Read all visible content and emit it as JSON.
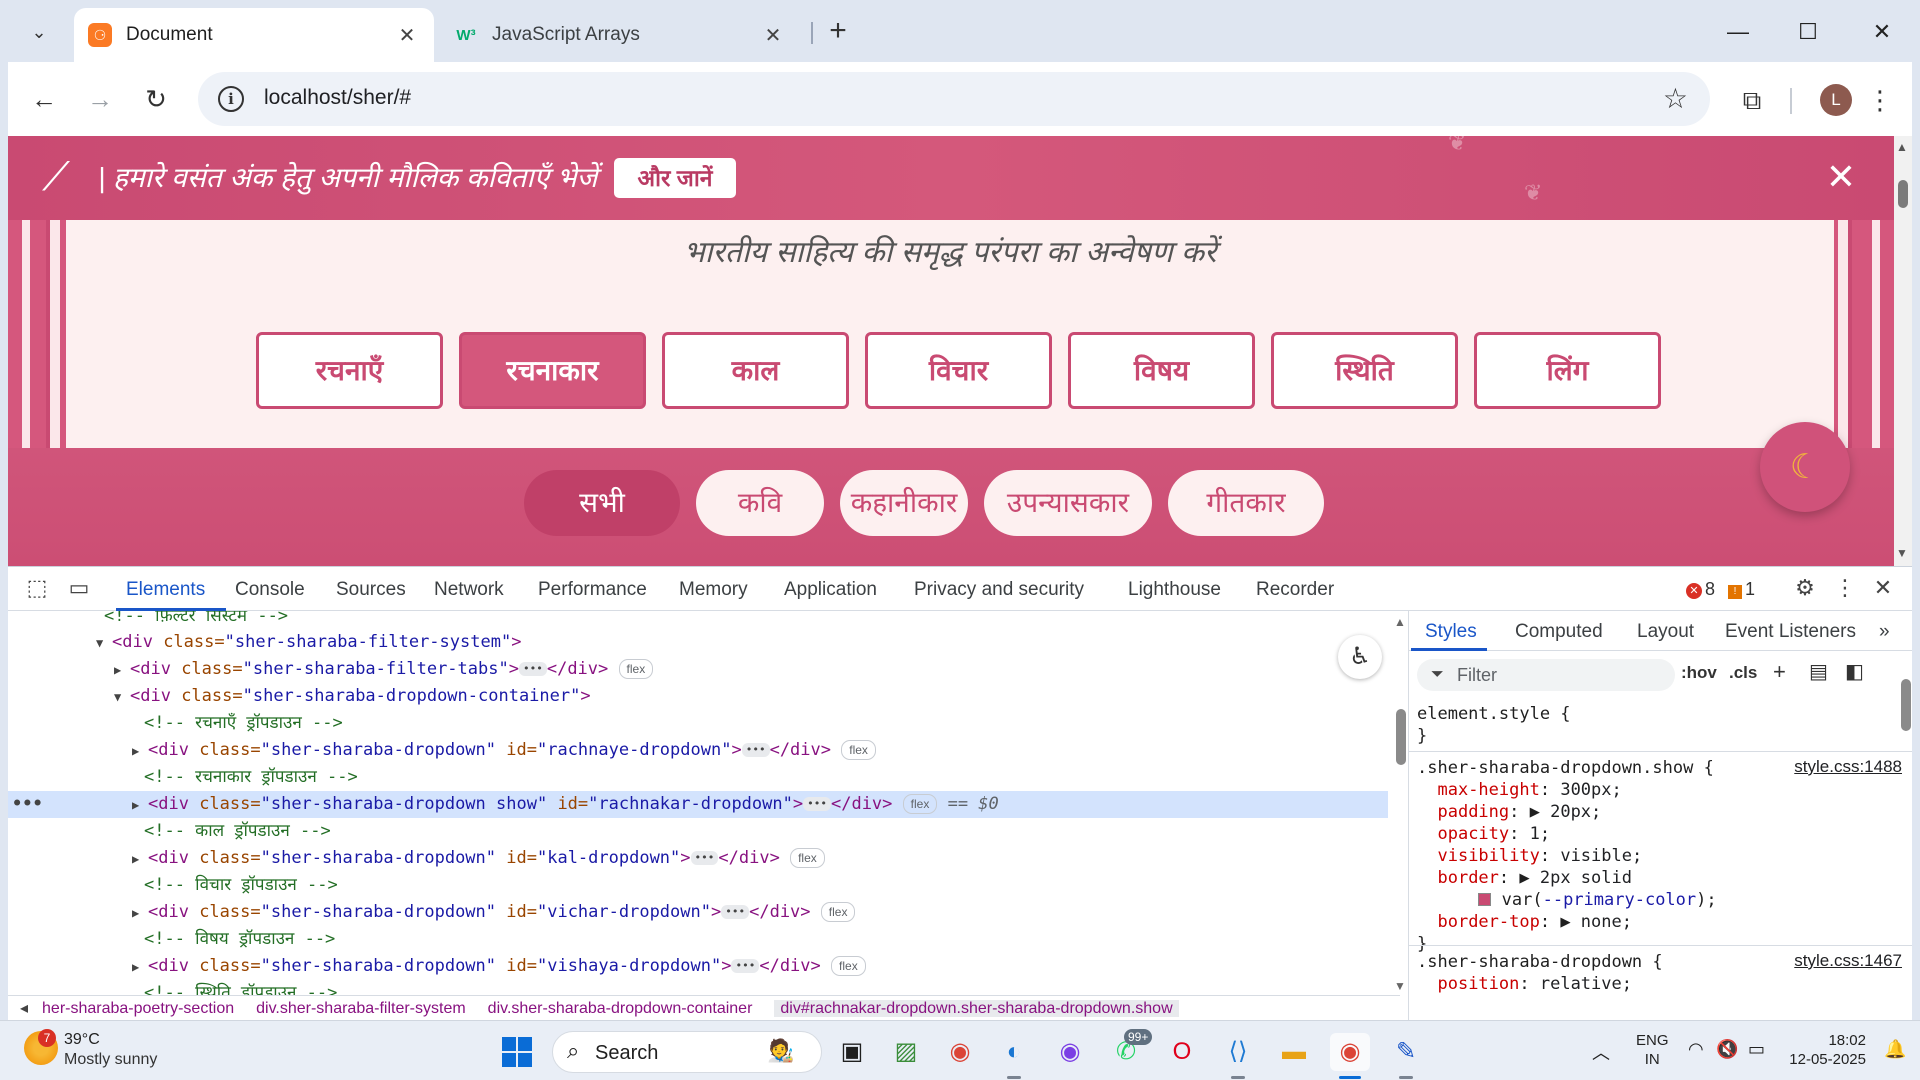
{
  "browser": {
    "tabs": [
      {
        "title": "Document",
        "favicon": "xampp-icon",
        "favicon_glyph": "⚆",
        "active": true
      },
      {
        "title": "JavaScript Arrays",
        "favicon": "w3schools-icon",
        "favicon_glyph": "W³",
        "active": false
      }
    ],
    "url": "localhost/sher/#",
    "profile_initial": "L"
  },
  "page": {
    "announcement": {
      "text": "| हमारे वसंत अंक हेतु अपनी मौलिक कविताएँ भेजें",
      "button": "और जानें"
    },
    "subtitle": "भारतीय साहित्य की समृद्ध परंपरा का अन्वेषण करें",
    "filter_tabs": [
      "रचनाएँ",
      "रचनाकार",
      "काल",
      "विचार",
      "विषय",
      "स्थिति",
      "लिंग"
    ],
    "active_filter": "रचनाकार",
    "sub_filters": [
      "सभी",
      "कवि",
      "कहानीकार",
      "उपन्यासकार",
      "गीतकार"
    ],
    "active_sub_filter": "सभी",
    "colors": {
      "primary": "#c94a72",
      "primary_dark": "#c04068",
      "background": "#fdf0f0"
    }
  },
  "devtools": {
    "tabs": [
      "Elements",
      "Console",
      "Sources",
      "Network",
      "Performance",
      "Memory",
      "Application",
      "Privacy and security",
      "Lighthouse",
      "Recorder"
    ],
    "active_tab": "Elements",
    "error_count": "8",
    "warning_count": "1",
    "dom_lines": {
      "l0": "<!-- फ़िल्टर सिस्टम -->",
      "l1_tag": "<div ",
      "l1_attr": "class=",
      "l1_val": "\"sher-sharaba-filter-system\"",
      "l1_end": ">",
      "l2_attr": "class=",
      "l2_val": "\"sher-sharaba-filter-tabs\"",
      "l3_attr": "class=",
      "l3_val": "\"sher-sharaba-dropdown-container\"",
      "l4": "<!-- रचनाएँ ड्रॉपडाउन -->",
      "l5_val": "\"sher-sharaba-dropdown\"",
      "l5_id": "\"rachnaye-dropdown\"",
      "l6": "<!-- रचनाकार ड्रॉपडाउन -->",
      "l7_val": "\"sher-sharaba-dropdown show\"",
      "l7_id": "\"rachnakar-dropdown\"",
      "l8": "<!-- काल ड्रॉपडाउन -->",
      "l9_val": "\"sher-sharaba-dropdown\"",
      "l9_id": "\"kal-dropdown\"",
      "l10": "<!-- विचार ड्रॉपडाउन -->",
      "l11_val": "\"sher-sharaba-dropdown\"",
      "l11_id": "\"vichar-dropdown\"",
      "l12": "<!-- विषय ड्रॉपडाउन -->",
      "l13_val": "\"sher-sharaba-dropdown\"",
      "l13_id": "\"vishaya-dropdown\"",
      "l14": "<!-- स्थिति ड्रॉपडाउन -->",
      "flex": "flex",
      "selected_marker": "== $0"
    },
    "breadcrumbs": [
      "her-sharaba-poetry-section",
      "div.sher-sharaba-filter-system",
      "div.sher-sharaba-dropdown-container",
      "div#rachnakar-dropdown.sher-sharaba-dropdown.show"
    ],
    "styles_panel": {
      "tabs": [
        "Styles",
        "Computed",
        "Layout",
        "Event Listeners"
      ],
      "active_tab": "Styles",
      "filter_placeholder": "Filter",
      "hov": ":hov",
      "cls": ".cls",
      "element_style": "element.style {",
      "close_brace": "}",
      "rule1_selector": ".sher-sharaba-dropdown.show {",
      "rule1_source": "style.css:1488",
      "rule1_props": [
        {
          "name": "max-height",
          "value": "300px;"
        },
        {
          "name": "padding",
          "value": "20px;"
        },
        {
          "name": "opacity",
          "value": "1;"
        },
        {
          "name": "visibility",
          "value": "visible;"
        },
        {
          "name": "border",
          "value": "2px solid"
        },
        {
          "name": "border-top",
          "value": "none;"
        }
      ],
      "border_var": "--primary-color",
      "rule2_selector": ".sher-sharaba-dropdown {",
      "rule2_source": "style.css:1467",
      "rule2_props": [
        {
          "name": "position",
          "value": "relative;"
        }
      ]
    }
  },
  "taskbar": {
    "weather_temp": "39°C",
    "weather_condition": "Mostly sunny",
    "weather_badge": "7",
    "search_label": "Search",
    "whatsapp_badge": "99+",
    "language": "ENG",
    "region": "IN",
    "time": "18:02",
    "date": "12-05-2025"
  }
}
